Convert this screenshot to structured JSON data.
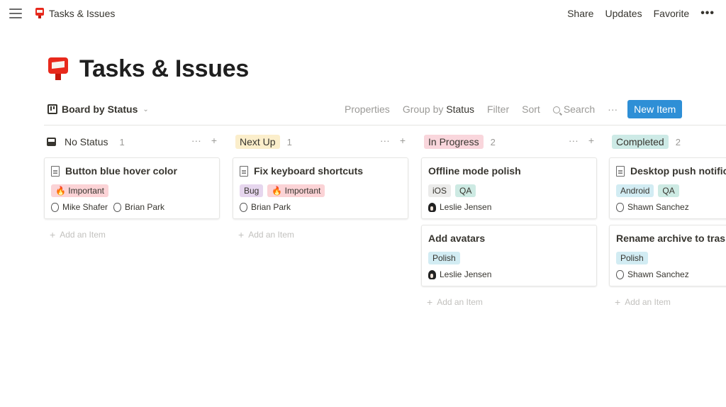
{
  "topbar": {
    "breadcrumb": "Tasks & Issues",
    "actions": [
      "Share",
      "Updates",
      "Favorite"
    ],
    "more": "•••"
  },
  "page": {
    "title": "Tasks & Issues",
    "icon": "mailbox-icon"
  },
  "view": {
    "name": "Board by Status",
    "properties": "Properties",
    "group_by_label": "Group by",
    "group_by_value": "Status",
    "filter": "Filter",
    "sort": "Sort",
    "search": "Search",
    "more": "···",
    "new_item": "New Item"
  },
  "colors": {
    "accent": "#2e8fd6",
    "no_status": "#ffffff",
    "next_up": "#fbeecb",
    "in_progress": "#f9d6dc",
    "completed": "#cdeae6",
    "tag_important": "#fbd3d6",
    "tag_bug": "#e6d6ee",
    "tag_ios": "#ebebea",
    "tag_qa": "#cdeae3",
    "tag_polish": "#d2ecf3",
    "tag_android": "#d2ecf3"
  },
  "board": {
    "add_label": "Add an Item",
    "columns": [
      {
        "name": "No Status",
        "count": "1",
        "cards": [
          {
            "title": "Button blue hover color",
            "doc": true,
            "tags": [
              "🔥 Important"
            ],
            "people": [
              "Mike Shafer",
              "Brian Park"
            ]
          }
        ]
      },
      {
        "name": "Next Up",
        "count": "1",
        "cards": [
          {
            "title": "Fix keyboard shortcuts",
            "doc": true,
            "tags": [
              "Bug",
              "🔥 Important"
            ],
            "people": [
              "Brian Park"
            ]
          }
        ]
      },
      {
        "name": "In Progress",
        "count": "2",
        "cards": [
          {
            "title": "Offline mode polish",
            "doc": false,
            "tags": [
              "iOS",
              "QA"
            ],
            "people": [
              "Leslie Jensen"
            ]
          },
          {
            "title": "Add avatars",
            "doc": false,
            "tags": [
              "Polish"
            ],
            "people": [
              "Leslie Jensen"
            ]
          }
        ]
      },
      {
        "name": "Completed",
        "count": "2",
        "cards": [
          {
            "title": "Desktop push notifications",
            "doc": true,
            "tags": [
              "Android",
              "QA"
            ],
            "people": [
              "Shawn Sanchez"
            ]
          },
          {
            "title": "Rename archive to trash",
            "doc": false,
            "tags": [
              "Polish"
            ],
            "people": [
              "Shawn Sanchez"
            ]
          }
        ]
      }
    ]
  }
}
